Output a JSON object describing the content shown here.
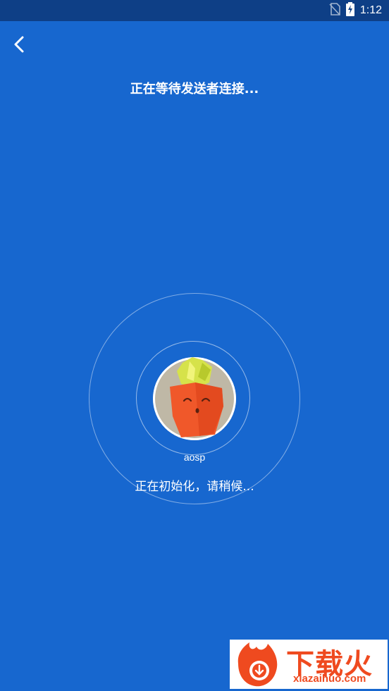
{
  "status_bar": {
    "time": "1:12",
    "icons": [
      "no-sim-icon",
      "battery-charging-icon"
    ]
  },
  "header": {
    "back_icon": "chevron-left-icon",
    "title": "正在等待发送者连接..."
  },
  "receiver": {
    "avatar_icon": "carrot-avatar-icon",
    "device_name": "aosp",
    "status": "正在初始化，请稍候..."
  },
  "watermark": {
    "brand": "下载火",
    "url": "xiazaihuo.com"
  },
  "colors": {
    "background": "#1767cf",
    "status_bar": "#0e3f86",
    "watermark_accent": "#ef4a1f"
  }
}
